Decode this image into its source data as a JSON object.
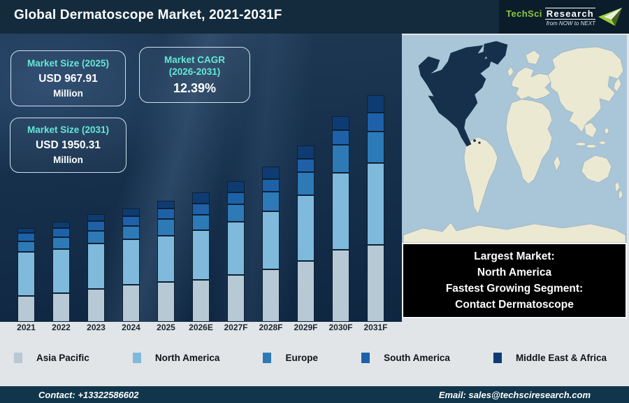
{
  "header": {
    "title": "Global Dermatoscope Market, 2021-2031F",
    "logo": {
      "brand_primary": "TechSci",
      "brand_secondary": "Research",
      "tagline": "from NOW to NEXT"
    }
  },
  "stats": [
    {
      "label": "Market Size (2025)",
      "value": "USD 967.91",
      "unit": "Million"
    },
    {
      "label": "Market CAGR",
      "label2": "(2026-2031)",
      "value": "12.39%"
    },
    {
      "label": "Market Size (2031)",
      "value": "USD 1950.31",
      "unit": "Million"
    }
  ],
  "chart_data": {
    "type": "bar",
    "stacked": true,
    "title": "Global Dermatoscope Market, 2021-2031F",
    "unit": "USD Million",
    "xlabel": "",
    "ylabel": "",
    "grid": false,
    "legend_position": "bottom",
    "categories": [
      "2021",
      "2022",
      "2023",
      "2024",
      "2025",
      "2026E",
      "2027F",
      "2028F",
      "2029F",
      "2030F",
      "2031F"
    ],
    "series": [
      {
        "name": "Asia Pacific",
        "color": "#b6c9d5",
        "values": [
          207,
          230,
          262,
          296,
          319,
          336,
          375,
          420,
          487,
          577,
          616
        ]
      },
      {
        "name": "North America",
        "color": "#7fbadc",
        "values": [
          353,
          350,
          364,
          365,
          370,
          398,
          426,
          465,
          526,
          616,
          655
        ]
      },
      {
        "name": "Europe",
        "color": "#2e7ab7",
        "values": [
          84,
          95,
          98,
          106,
          134,
          123,
          140,
          157,
          185,
          224,
          252
        ]
      },
      {
        "name": "South America",
        "color": "#1e61a9",
        "values": [
          67,
          73,
          76,
          78,
          84,
          90,
          95,
          101,
          106,
          118,
          151
        ]
      },
      {
        "name": "Middle East & Africa",
        "color": "#0e3c72",
        "values": [
          39,
          52,
          56,
          62,
          61,
          88,
          90,
          100,
          105,
          112,
          140
        ]
      }
    ],
    "annotations": {
      "market_size_2025": "USD 967.91 Million",
      "market_size_2031": "USD 1950.31 Million",
      "cagr_2026_2031": "12.39%"
    },
    "note": "segment values estimated from bar heights; totals anchored to stated 2025 market size"
  },
  "callout": {
    "lines": [
      "Largest Market:",
      "North America",
      "Fastest Growing Segment:",
      "Contact Dermatoscope"
    ]
  },
  "map": {
    "highlight_region": "North America",
    "highlight_color": "#16304b",
    "ocean_color": "#a9c6d8",
    "land_color": "#ece9d3"
  },
  "footer": {
    "contact": "Contact: +13322586602",
    "email": "Email: sales@techsciresearch.com"
  }
}
